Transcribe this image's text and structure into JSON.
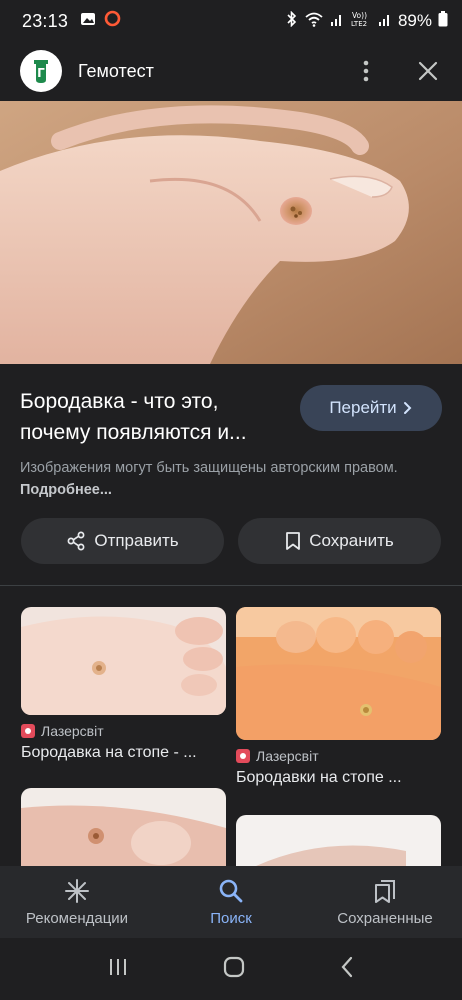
{
  "status_bar": {
    "time": "23:13",
    "battery": "89%",
    "network_label": "LTE2"
  },
  "header": {
    "site_name": "Гемотест",
    "logo_letter": "Г"
  },
  "result": {
    "title_line1": "Бородавка - что это,",
    "title_line2": "почему появляются и...",
    "go_label": "Перейти",
    "copyright_text": "Изображения могут быть защищены авторским правом.",
    "more_link": "Подробнее..."
  },
  "actions": {
    "share_label": "Отправить",
    "save_label": "Сохранить"
  },
  "related": [
    {
      "source": "Лазерсвіт",
      "title": "Бородавка на стопе - ..."
    },
    {
      "source": "Лазерсвіт",
      "title": "Бородавки на стопе ..."
    }
  ],
  "bottom_nav": {
    "items": [
      {
        "label": "Рекомендации",
        "icon": "asterisk-icon"
      },
      {
        "label": "Поиск",
        "icon": "search-icon",
        "active": true
      },
      {
        "label": "Сохраненные",
        "icon": "saved-icon"
      }
    ]
  },
  "colors": {
    "background": "#1f1f21",
    "accent": "#8ab4f8",
    "go_button_bg": "#394457"
  }
}
